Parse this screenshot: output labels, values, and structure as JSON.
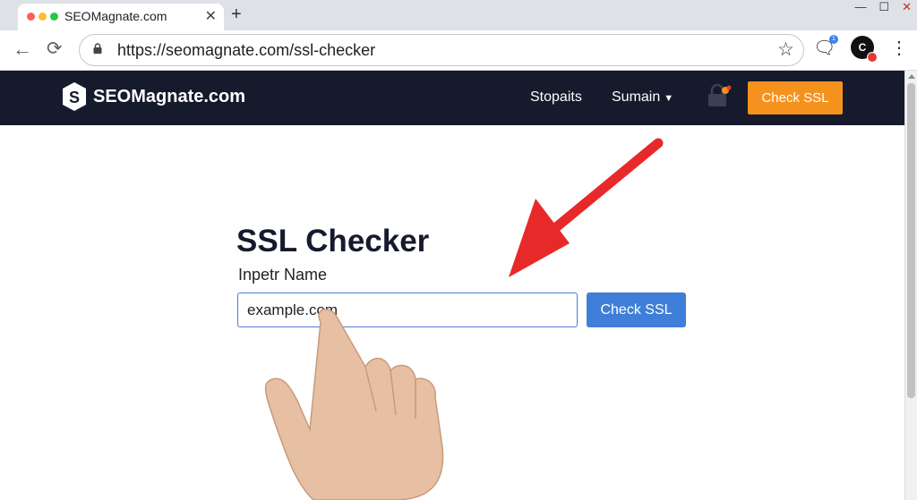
{
  "browser": {
    "tab_title": "SEOMagnate.com",
    "url": "https://seomagnate.com/ssl-checker",
    "window_controls": [
      "—",
      "☐",
      "✕"
    ],
    "avatar_text": "C",
    "ext_badge": "1"
  },
  "site": {
    "brand": "SEOMagnate.com",
    "logo_letter": "S",
    "nav": {
      "link1": "Stopaits",
      "link2": "Sumain",
      "cta": "Check SSL"
    }
  },
  "main": {
    "title": "SSL Checker",
    "input_label": "Inpetr Name",
    "input_value": "example.com",
    "button": "Check SSL"
  },
  "colors": {
    "navbar": "#151a2c",
    "cta": "#f5921e",
    "button": "#3f7fd9",
    "arrow": "#e8292a"
  }
}
